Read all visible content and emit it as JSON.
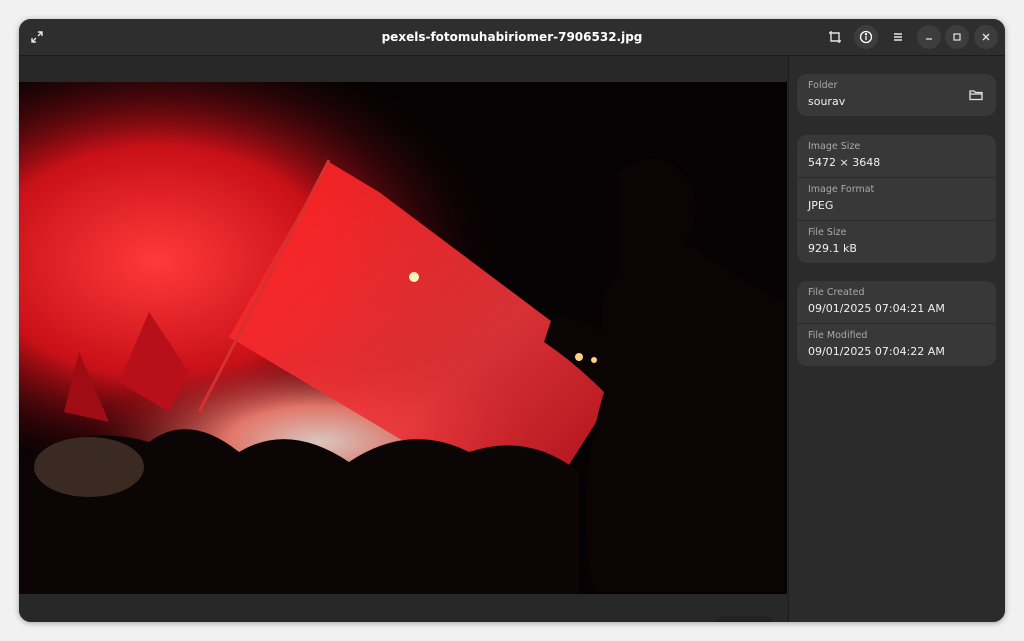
{
  "window": {
    "title": "pexels-fotomuhabiriomer-7906532.jpg"
  },
  "headerbar": {
    "icons": [
      "fullscreen-icon",
      "crop-icon",
      "info-icon",
      "menu-icon",
      "minimize-icon",
      "maximize-icon",
      "close-icon"
    ]
  },
  "viewer": {
    "zoom_icon": "zoom-in-icon",
    "dropdown_icon": "chevron-down-icon"
  },
  "properties": {
    "folder": {
      "label": "Folder",
      "value": "sourav"
    },
    "image_size": {
      "label": "Image Size",
      "value": "5472 × 3648"
    },
    "image_format": {
      "label": "Image Format",
      "value": "JPEG"
    },
    "file_size": {
      "label": "File Size",
      "value": "929.1 kB"
    },
    "file_created": {
      "label": "File Created",
      "value": "09/01/2025 07:04:21 AM"
    },
    "file_modified": {
      "label": "File Modified",
      "value": "09/01/2025 07:04:22 AM"
    }
  },
  "colors": {
    "window_bg": "#242424",
    "headerbar_bg": "#2e2e2e",
    "sidebar_bg": "#2b2b2b",
    "card_bg": "#383838",
    "photo_red": "#e0101a"
  }
}
